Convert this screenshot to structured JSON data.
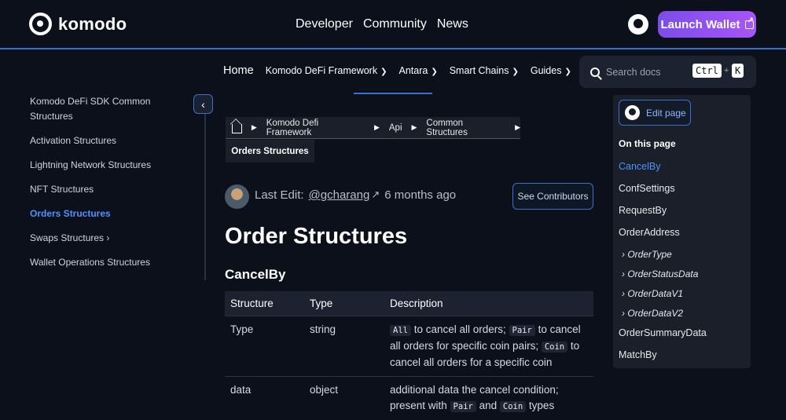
{
  "brand": {
    "name": "komodo"
  },
  "topnav": [
    "Developer",
    "Community",
    "News"
  ],
  "launch": {
    "label": "Launch Wallet"
  },
  "subnav": {
    "home": "Home",
    "items": [
      "Komodo DeFi Framework",
      "Antara",
      "Smart Chains",
      "Guides"
    ]
  },
  "search": {
    "placeholder": "Search docs",
    "key1": "Ctrl",
    "plus": "+",
    "key2": "K"
  },
  "sidebar": {
    "items": [
      "Komodo DeFi SDK Common Structures",
      "Activation Structures",
      "Lightning Network Structures",
      "NFT Structures",
      "Orders Structures",
      "Swaps Structures",
      "Wallet Operations Structures"
    ],
    "active_index": 4
  },
  "breadcrumb": {
    "items": [
      "Komodo Defi Framework",
      "Api",
      "Common Structures"
    ],
    "current": "Orders Structures"
  },
  "meta": {
    "prefix": "Last Edit:",
    "user": "@gcharang",
    "arrow": "↗",
    "time": "6 months ago",
    "contributors": "See Contributors"
  },
  "page": {
    "title": "Order Structures",
    "section": "CancelBy"
  },
  "table": {
    "headers": [
      "Structure",
      "Type",
      "Description"
    ],
    "rows": [
      {
        "structure": "Type",
        "type": "string",
        "d1": "All",
        "d2": " to cancel all orders; ",
        "d3": "Pair",
        "d4": " to cancel all orders for specific coin pairs; ",
        "d5": "Coin",
        "d6": " to cancel all orders for a specific coin"
      },
      {
        "structure": "data",
        "type": "object",
        "d1": "additional data the cancel condition; present with ",
        "d2": "Pair",
        "d3": " and ",
        "d4": "Coin",
        "d5": " types"
      }
    ]
  },
  "toc": {
    "edit": "Edit page",
    "heading": "On this page",
    "items": [
      "CancelBy",
      "ConfSettings",
      "RequestBy",
      "OrderAddress"
    ],
    "sub": [
      "OrderType",
      "OrderStatusData",
      "OrderDataV1",
      "OrderDataV2"
    ],
    "items2": [
      "OrderSummaryData",
      "MatchBy"
    ]
  }
}
